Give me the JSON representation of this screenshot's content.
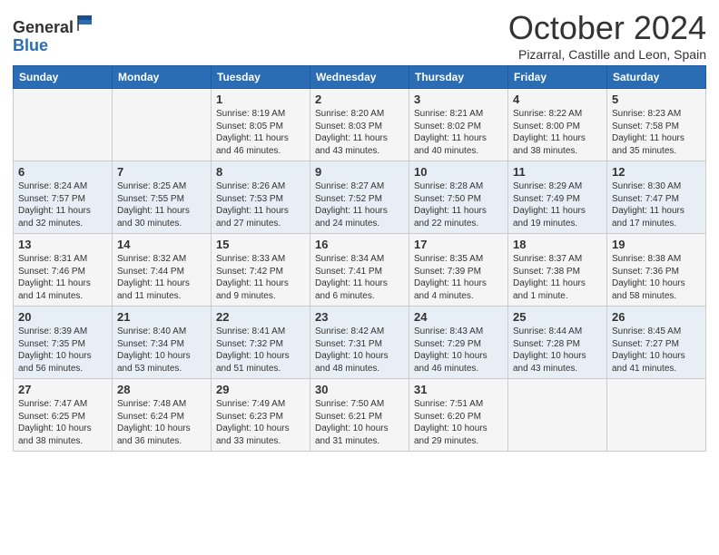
{
  "header": {
    "logo": {
      "general": "General",
      "blue": "Blue"
    },
    "title": "October 2024",
    "subtitle": "Pizarral, Castille and Leon, Spain"
  },
  "days_of_week": [
    "Sunday",
    "Monday",
    "Tuesday",
    "Wednesday",
    "Thursday",
    "Friday",
    "Saturday"
  ],
  "weeks": [
    [
      {
        "day": "",
        "info": ""
      },
      {
        "day": "",
        "info": ""
      },
      {
        "day": "1",
        "info": "Sunrise: 8:19 AM\nSunset: 8:05 PM\nDaylight: 11 hours and 46 minutes."
      },
      {
        "day": "2",
        "info": "Sunrise: 8:20 AM\nSunset: 8:03 PM\nDaylight: 11 hours and 43 minutes."
      },
      {
        "day": "3",
        "info": "Sunrise: 8:21 AM\nSunset: 8:02 PM\nDaylight: 11 hours and 40 minutes."
      },
      {
        "day": "4",
        "info": "Sunrise: 8:22 AM\nSunset: 8:00 PM\nDaylight: 11 hours and 38 minutes."
      },
      {
        "day": "5",
        "info": "Sunrise: 8:23 AM\nSunset: 7:58 PM\nDaylight: 11 hours and 35 minutes."
      }
    ],
    [
      {
        "day": "6",
        "info": "Sunrise: 8:24 AM\nSunset: 7:57 PM\nDaylight: 11 hours and 32 minutes."
      },
      {
        "day": "7",
        "info": "Sunrise: 8:25 AM\nSunset: 7:55 PM\nDaylight: 11 hours and 30 minutes."
      },
      {
        "day": "8",
        "info": "Sunrise: 8:26 AM\nSunset: 7:53 PM\nDaylight: 11 hours and 27 minutes."
      },
      {
        "day": "9",
        "info": "Sunrise: 8:27 AM\nSunset: 7:52 PM\nDaylight: 11 hours and 24 minutes."
      },
      {
        "day": "10",
        "info": "Sunrise: 8:28 AM\nSunset: 7:50 PM\nDaylight: 11 hours and 22 minutes."
      },
      {
        "day": "11",
        "info": "Sunrise: 8:29 AM\nSunset: 7:49 PM\nDaylight: 11 hours and 19 minutes."
      },
      {
        "day": "12",
        "info": "Sunrise: 8:30 AM\nSunset: 7:47 PM\nDaylight: 11 hours and 17 minutes."
      }
    ],
    [
      {
        "day": "13",
        "info": "Sunrise: 8:31 AM\nSunset: 7:46 PM\nDaylight: 11 hours and 14 minutes."
      },
      {
        "day": "14",
        "info": "Sunrise: 8:32 AM\nSunset: 7:44 PM\nDaylight: 11 hours and 11 minutes."
      },
      {
        "day": "15",
        "info": "Sunrise: 8:33 AM\nSunset: 7:42 PM\nDaylight: 11 hours and 9 minutes."
      },
      {
        "day": "16",
        "info": "Sunrise: 8:34 AM\nSunset: 7:41 PM\nDaylight: 11 hours and 6 minutes."
      },
      {
        "day": "17",
        "info": "Sunrise: 8:35 AM\nSunset: 7:39 PM\nDaylight: 11 hours and 4 minutes."
      },
      {
        "day": "18",
        "info": "Sunrise: 8:37 AM\nSunset: 7:38 PM\nDaylight: 11 hours and 1 minute."
      },
      {
        "day": "19",
        "info": "Sunrise: 8:38 AM\nSunset: 7:36 PM\nDaylight: 10 hours and 58 minutes."
      }
    ],
    [
      {
        "day": "20",
        "info": "Sunrise: 8:39 AM\nSunset: 7:35 PM\nDaylight: 10 hours and 56 minutes."
      },
      {
        "day": "21",
        "info": "Sunrise: 8:40 AM\nSunset: 7:34 PM\nDaylight: 10 hours and 53 minutes."
      },
      {
        "day": "22",
        "info": "Sunrise: 8:41 AM\nSunset: 7:32 PM\nDaylight: 10 hours and 51 minutes."
      },
      {
        "day": "23",
        "info": "Sunrise: 8:42 AM\nSunset: 7:31 PM\nDaylight: 10 hours and 48 minutes."
      },
      {
        "day": "24",
        "info": "Sunrise: 8:43 AM\nSunset: 7:29 PM\nDaylight: 10 hours and 46 minutes."
      },
      {
        "day": "25",
        "info": "Sunrise: 8:44 AM\nSunset: 7:28 PM\nDaylight: 10 hours and 43 minutes."
      },
      {
        "day": "26",
        "info": "Sunrise: 8:45 AM\nSunset: 7:27 PM\nDaylight: 10 hours and 41 minutes."
      }
    ],
    [
      {
        "day": "27",
        "info": "Sunrise: 7:47 AM\nSunset: 6:25 PM\nDaylight: 10 hours and 38 minutes."
      },
      {
        "day": "28",
        "info": "Sunrise: 7:48 AM\nSunset: 6:24 PM\nDaylight: 10 hours and 36 minutes."
      },
      {
        "day": "29",
        "info": "Sunrise: 7:49 AM\nSunset: 6:23 PM\nDaylight: 10 hours and 33 minutes."
      },
      {
        "day": "30",
        "info": "Sunrise: 7:50 AM\nSunset: 6:21 PM\nDaylight: 10 hours and 31 minutes."
      },
      {
        "day": "31",
        "info": "Sunrise: 7:51 AM\nSunset: 6:20 PM\nDaylight: 10 hours and 29 minutes."
      },
      {
        "day": "",
        "info": ""
      },
      {
        "day": "",
        "info": ""
      }
    ]
  ]
}
